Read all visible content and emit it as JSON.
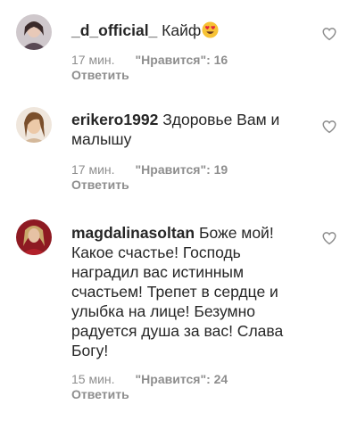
{
  "comments": [
    {
      "username": "_d_official_",
      "text": "Кайф",
      "time": "17 мин.",
      "likes": "\"Нравится\": 16",
      "reply": "Ответить",
      "emoji": "heart-eyes-emoji"
    },
    {
      "username": "erikero1992",
      "text": "Здоровье Вам и малышу",
      "time": "17 мин.",
      "likes": "\"Нравится\": 19",
      "reply": "Ответить"
    },
    {
      "username": "magdalinasoltan",
      "text": "Боже мой! Какое счастье! Господь наградил вас истинным счастьем! Трепет в сердце и улыбка на лице! Безумно радуется душа за вас! Слава Богу!",
      "time": "15 мин.",
      "likes": "\"Нравится\": 24",
      "reply": "Ответить"
    }
  ],
  "colors": {
    "text": "#262626",
    "muted": "#8e8e8e",
    "heart_outline": "#8e8e8e"
  },
  "icons": {
    "like": "heart-outline-icon"
  }
}
